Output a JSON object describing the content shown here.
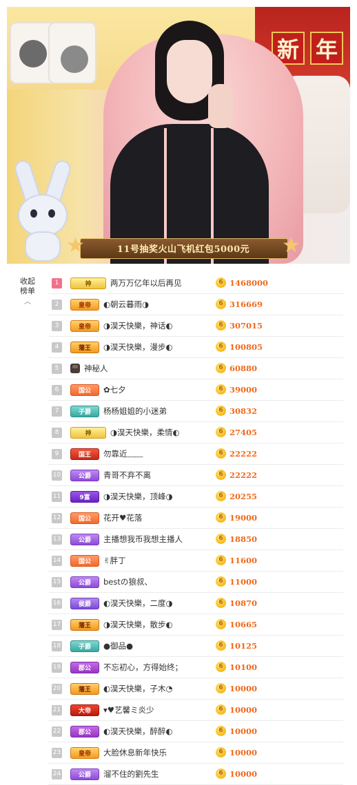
{
  "stream": {
    "banner_text": "11号抽奖火山飞机红包5000元",
    "new_year_chars": [
      "新",
      "年"
    ]
  },
  "panel": {
    "collapse_label_1": "收起",
    "collapse_label_2": "榜单",
    "collapse_icon": "chevron-up-icon"
  },
  "colors": {
    "score": "#f06a1c",
    "first_rank": "#f4708a",
    "rank_default": "#c8c8c8"
  },
  "ranking": [
    {
      "rank": "1",
      "badge": "神",
      "name": "两万万亿年以后再见",
      "score": "1468000"
    },
    {
      "rank": "2",
      "badge": "皇帝",
      "name": "◐朝云暮雨◑",
      "score": "316669"
    },
    {
      "rank": "3",
      "badge": "皇帝",
      "name": "◑淏天快樂，神话◐",
      "score": "307015"
    },
    {
      "rank": "4",
      "badge": "藩王",
      "name": "◑淏天快樂，漫步◐",
      "score": "100805"
    },
    {
      "rank": "5",
      "badge": "",
      "name": "神秘人",
      "score": "60880"
    },
    {
      "rank": "6",
      "badge": "国公",
      "name": "✿七夕",
      "score": "39000"
    },
    {
      "rank": "7",
      "badge": "子爵",
      "name": "杨杨姐姐的小迷弟",
      "score": "30832"
    },
    {
      "rank": "8",
      "badge": "神",
      "name": "◑淏天快樂，柔情◐",
      "score": "27405"
    },
    {
      "rank": "9",
      "badge": "国王",
      "name": "勿靠近﹏﹏",
      "score": "22222"
    },
    {
      "rank": "10",
      "badge": "公爵",
      "name": "青哥不弃不离",
      "score": "22222"
    },
    {
      "rank": "11",
      "badge": "9富",
      "name": "◑淏天快樂，顶峰◑",
      "score": "20255"
    },
    {
      "rank": "12",
      "badge": "国公",
      "name": "花开♥花落",
      "score": "19000"
    },
    {
      "rank": "13",
      "badge": "公爵",
      "name": "主播想我币我想主播人",
      "score": "18850"
    },
    {
      "rank": "14",
      "badge": "国公",
      "name": "✌胖丁",
      "score": "11600"
    },
    {
      "rank": "15",
      "badge": "公爵",
      "name": "bestの狼叔、",
      "score": "11000"
    },
    {
      "rank": "16",
      "badge": "侯爵",
      "name": "◐淏天快樂，二度◑",
      "score": "10870"
    },
    {
      "rank": "17",
      "badge": "藩王",
      "name": "◑淏天快樂，散步◐",
      "score": "10665"
    },
    {
      "rank": "18",
      "badge": "子爵",
      "name": "●御品●",
      "score": "10125"
    },
    {
      "rank": "19",
      "badge": "郡公",
      "name": "不忘初心，方得始终；",
      "score": "10100"
    },
    {
      "rank": "20",
      "badge": "藩王",
      "name": "◐淏天快樂，子木◔",
      "score": "10000"
    },
    {
      "rank": "21",
      "badge": "大帝",
      "name": "▾♥艺馨ミ炎少",
      "score": "10000"
    },
    {
      "rank": "22",
      "badge": "郡公",
      "name": "◐淏天快樂，醉醉◐",
      "score": "10000"
    },
    {
      "rank": "23",
      "badge": "皇帝",
      "name": "大脸休息新年快乐",
      "score": "10000"
    },
    {
      "rank": "24",
      "badge": "公爵",
      "name": "溜不住的劉先生",
      "score": "10000"
    }
  ]
}
